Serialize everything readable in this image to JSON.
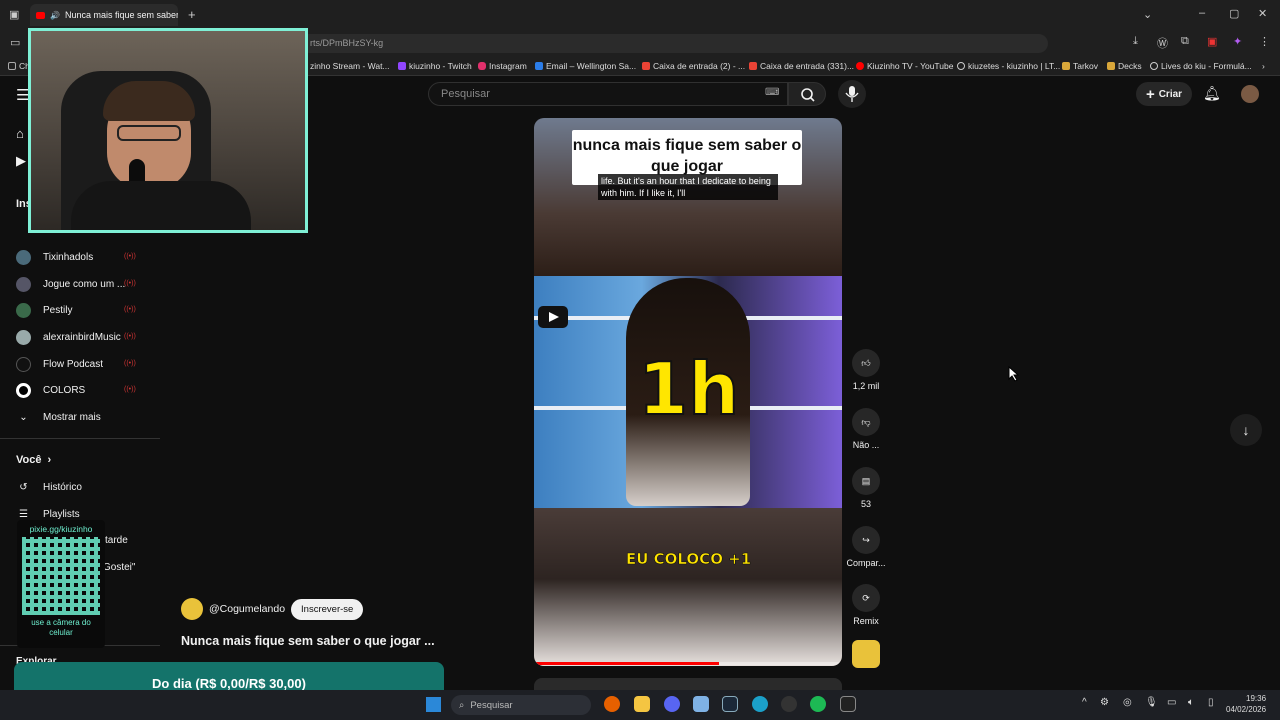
{
  "browser": {
    "tab_title": "Nunca mais fique sem saber",
    "url": "rts/DPmBHzSY-kg",
    "bookmarks": [
      {
        "label": "zinho Stream - Wat...",
        "color": "#888"
      },
      {
        "label": "kiuzinho - Twitch",
        "color": "#9146ff"
      },
      {
        "label": "Instagram",
        "color": "#e1306c"
      },
      {
        "label": "Email – Wellington Sa...",
        "color": "#2b7de9"
      },
      {
        "label": "Caixa de entrada (2) - ...",
        "color": "#ea4335"
      },
      {
        "label": "Caixa de entrada (331)...",
        "color": "#ea4335"
      },
      {
        "label": "Kiuzinho TV - YouTube",
        "color": "#ff0000"
      },
      {
        "label": "kiuzetes - kiuzinho | LT...",
        "color": "#ccc"
      },
      {
        "label": "Tarkov",
        "color": "#d9a73a"
      },
      {
        "label": "Decks",
        "color": "#d9a73a"
      },
      {
        "label": "Lives do kiu - Formulá...",
        "color": "#ccc"
      }
    ]
  },
  "youtube": {
    "search_placeholder": "Pesquisar",
    "create_label": "Criar",
    "sidebar": {
      "section_label": "Ins",
      "channels": [
        {
          "name": "Tixinhadols",
          "live": "((•))"
        },
        {
          "name": "Jogue como um ...",
          "live": "((•))"
        },
        {
          "name": "Pestily",
          "live": "((•))"
        },
        {
          "name": "alexrainbirdMusic",
          "live": "((•))"
        },
        {
          "name": "Flow Podcast",
          "live": "((•))"
        },
        {
          "name": "COLORS",
          "live": "((•))"
        }
      ],
      "show_more": "Mostrar mais",
      "you_label": "Você",
      "history": "Histórico",
      "playlists": "Playlists",
      "watch_later_fragment": "tarde",
      "liked_fragment": "Gostei\"",
      "explore_fragment": "Explorar"
    },
    "short": {
      "header_text": "nunca mais fique sem saber o que jogar",
      "caption": "life.  But it's an hour that I dedicate to being with him.  If I like it, I'll",
      "big_text": "1h",
      "bottom_text": "EU COLOCO +1",
      "progress_fraction": 0.6,
      "channel": "@Cogumelando",
      "subscribe": "Inscrever-se",
      "title": "Nunca mais fique sem saber o que jogar ..."
    },
    "actions": {
      "like_count": "1,2 mil",
      "dislike_label": "Não ...",
      "comments_count": "53",
      "share_label": "Compar...",
      "remix_label": "Remix"
    }
  },
  "overlay": {
    "qr_url": "pixie.gg/kiuzinho",
    "qr_hint": "use a câmera do celular",
    "donation": "Do dia (R$ 0,00/R$ 30,00)"
  },
  "taskbar": {
    "search_placeholder": "Pesquisar",
    "time": "19:36",
    "date": "04/02/2026"
  },
  "colors": {
    "accent_teal": "#14736a",
    "webcam_border": "#7ff0d6",
    "youtube_red": "#ff0000"
  }
}
